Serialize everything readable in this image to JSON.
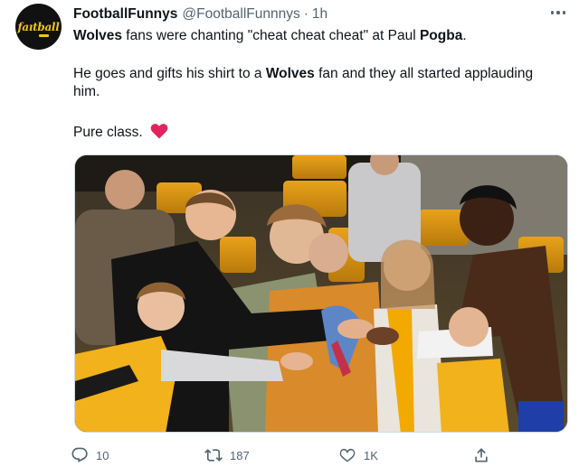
{
  "tweet": {
    "author": {
      "name": "FootballFunnys",
      "handle": "@FootballFunnnys",
      "separator": "·",
      "time": "1h",
      "avatar_text": "faıtball"
    },
    "text": {
      "p1_a": "Wolves",
      "p1_b": " fans were chanting \"cheat cheat cheat\" at Paul ",
      "p1_c": "Pogba",
      "p1_d": ".",
      "p2_a": "He goes and gifts his shirt to a ",
      "p2_b": "Wolves",
      "p2_c": " fan and they all started applauding him.",
      "p3": "Pure class."
    },
    "icons": {
      "more": "more-icon",
      "heart_emoji": "heart-emoji-icon",
      "reply": "reply-icon",
      "retweet": "retweet-icon",
      "like": "like-icon",
      "share": "share-icon"
    },
    "stats": {
      "replies": "10",
      "retweets": "187",
      "likes": "1K"
    },
    "colors": {
      "text": "#0f1419",
      "muted": "#536471",
      "heart": "#e0245e",
      "wolves_gold": "#f2a900"
    }
  }
}
